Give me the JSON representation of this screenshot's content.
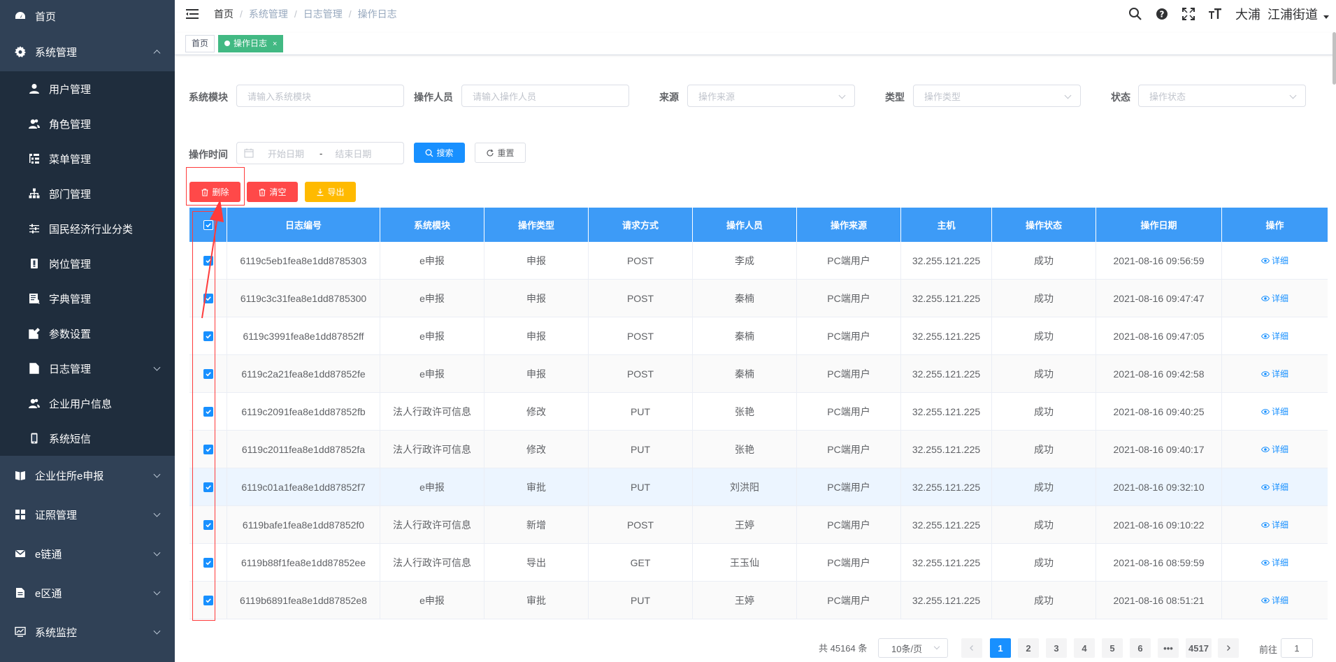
{
  "sidebar": {
    "items": [
      {
        "label": "首页",
        "icon": "dashboard-icon"
      },
      {
        "label": "系统管理",
        "icon": "gear-icon",
        "expanded": true
      },
      {
        "label": "用户管理",
        "icon": "user-icon"
      },
      {
        "label": "角色管理",
        "icon": "users-icon"
      },
      {
        "label": "菜单管理",
        "icon": "tree-table-icon"
      },
      {
        "label": "部门管理",
        "icon": "org-tree-icon"
      },
      {
        "label": "国民经济行业分类",
        "icon": "sliders-icon"
      },
      {
        "label": "岗位管理",
        "icon": "badge-icon"
      },
      {
        "label": "字典管理",
        "icon": "dictionary-icon"
      },
      {
        "label": "参数设置",
        "icon": "edit-icon"
      },
      {
        "label": "日志管理",
        "icon": "log-icon"
      },
      {
        "label": "企业用户信息",
        "icon": "users-icon"
      },
      {
        "label": "系统短信",
        "icon": "phone-icon"
      },
      {
        "label": "企业住所e申报",
        "icon": "book-icon"
      },
      {
        "label": "证照管理",
        "icon": "grid-icon"
      },
      {
        "label": "e链通",
        "icon": "mail-icon"
      },
      {
        "label": "e区通",
        "icon": "document-icon"
      },
      {
        "label": "系统监控",
        "icon": "monitor-icon"
      }
    ]
  },
  "navbar": {
    "breadcrumb": [
      "首页",
      "系统管理",
      "日志管理",
      "操作日志"
    ],
    "user_name": "大浦",
    "user_region": "江浦街道"
  },
  "tags": {
    "home": "首页",
    "active": "操作日志",
    "close": "×"
  },
  "filters": {
    "module_label": "系统模块",
    "module_placeholder": "请输入系统模块",
    "operator_label": "操作人员",
    "operator_placeholder": "请输入操作人员",
    "source_label": "来源",
    "source_placeholder": "操作来源",
    "type_label": "类型",
    "type_placeholder": "操作类型",
    "status_label": "状态",
    "status_placeholder": "操作状态",
    "time_label": "操作时间",
    "start_placeholder": "开始日期",
    "range_sep": "-",
    "end_placeholder": "结束日期",
    "search_label": "搜索",
    "reset_label": "重置"
  },
  "toolbar": {
    "delete_label": "删除",
    "clear_label": "清空",
    "export_label": "导出"
  },
  "table": {
    "columns": [
      "日志编号",
      "系统模块",
      "操作类型",
      "请求方式",
      "操作人员",
      "操作来源",
      "主机",
      "操作状态",
      "操作日期",
      "操作"
    ],
    "detail_label": "详细",
    "rows": [
      [
        "6119c5eb1fea8e1dd8785303",
        "e申报",
        "申报",
        "POST",
        "李成",
        "PC端用户",
        "32.255.121.225",
        "成功",
        "2021-08-16 09:56:59"
      ],
      [
        "6119c3c31fea8e1dd8785300",
        "e申报",
        "申报",
        "POST",
        "秦楠",
        "PC端用户",
        "32.255.121.225",
        "成功",
        "2021-08-16 09:47:47"
      ],
      [
        "6119c3991fea8e1dd87852ff",
        "e申报",
        "申报",
        "POST",
        "秦楠",
        "PC端用户",
        "32.255.121.225",
        "成功",
        "2021-08-16 09:47:05"
      ],
      [
        "6119c2a21fea8e1dd87852fe",
        "e申报",
        "申报",
        "POST",
        "秦楠",
        "PC端用户",
        "32.255.121.225",
        "成功",
        "2021-08-16 09:42:58"
      ],
      [
        "6119c2091fea8e1dd87852fb",
        "法人行政许可信息",
        "修改",
        "PUT",
        "张艳",
        "PC端用户",
        "32.255.121.225",
        "成功",
        "2021-08-16 09:40:25"
      ],
      [
        "6119c2011fea8e1dd87852fa",
        "法人行政许可信息",
        "修改",
        "PUT",
        "张艳",
        "PC端用户",
        "32.255.121.225",
        "成功",
        "2021-08-16 09:40:17"
      ],
      [
        "6119c01a1fea8e1dd87852f7",
        "e申报",
        "审批",
        "PUT",
        "刘洪阳",
        "PC端用户",
        "32.255.121.225",
        "成功",
        "2021-08-16 09:32:10"
      ],
      [
        "6119bafe1fea8e1dd87852f0",
        "法人行政许可信息",
        "新增",
        "POST",
        "王婷",
        "PC端用户",
        "32.255.121.225",
        "成功",
        "2021-08-16 09:10:22"
      ],
      [
        "6119b88f1fea8e1dd87852ee",
        "法人行政许可信息",
        "导出",
        "GET",
        "王玉仙",
        "PC端用户",
        "32.255.121.225",
        "成功",
        "2021-08-16 08:59:59"
      ],
      [
        "6119b6891fea8e1dd87852e8",
        "e申报",
        "审批",
        "PUT",
        "王婷",
        "PC端用户",
        "32.255.121.225",
        "成功",
        "2021-08-16 08:51:21"
      ]
    ]
  },
  "pagination": {
    "total_text": "共 45164 条",
    "page_size": "10条/页",
    "pages": [
      "1",
      "2",
      "3",
      "4",
      "5",
      "6",
      "•••",
      "4517"
    ],
    "current_page": 1,
    "goto_label": "前往",
    "goto_value": "1"
  },
  "colors": {
    "sidebar_bg": "#304156",
    "submenu_bg": "#1f2d3d",
    "table_header": "#3d9bf7",
    "primary": "#1890ff",
    "danger": "#ff4949",
    "warning": "#ffba00",
    "tag_active": "#42b983",
    "annotation": "#ff3b3b"
  }
}
